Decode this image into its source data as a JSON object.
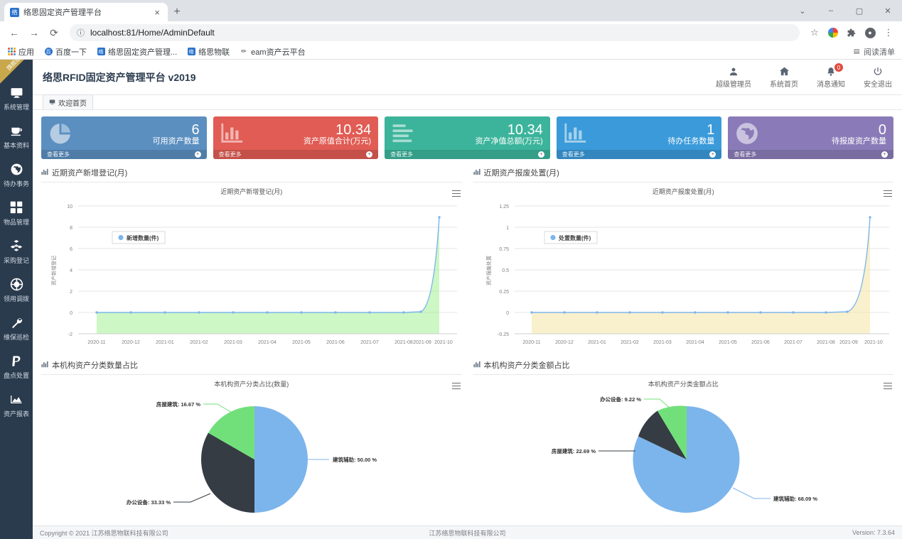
{
  "browser": {
    "tab": {
      "title": "络思固定资产管理平台",
      "favicon_icon": "app-favicon",
      "close_icon": "×"
    },
    "new_tab_icon": "+",
    "window_controls": {
      "minimize_all": "⌄",
      "minimize": "–",
      "maximize": "▢",
      "close": "✕"
    },
    "nav": {
      "back": "←",
      "forward": "→",
      "reload": "⟳",
      "info_icon": "ⓘ"
    },
    "url": "localhost:81/Home/AdminDefault",
    "toolbar_icons": {
      "star": "☆",
      "chrome": "chrome-logo",
      "extensions": "🧩",
      "profile": "👤",
      "menu": "⋮"
    },
    "bookmarks": [
      {
        "label": "应用",
        "icon": "apps-grid-icon"
      },
      {
        "label": "百度一下",
        "icon": "baidu-icon"
      },
      {
        "label": "络思固定资产管理...",
        "icon": "app-favicon"
      },
      {
        "label": "络思物联",
        "icon": "app-favicon"
      },
      {
        "label": "eam资产云平台",
        "icon": "pencil-icon"
      }
    ],
    "reading_list": {
      "label": "阅读清单",
      "icon": "reading-list-icon"
    }
  },
  "sidebar": {
    "ribbon": "旗舰版",
    "items": [
      {
        "label": "系统管理",
        "icon": "monitor-icon"
      },
      {
        "label": "基本资料",
        "icon": "cup-icon"
      },
      {
        "label": "待办事务",
        "icon": "globe-icon"
      },
      {
        "label": "物品管理",
        "icon": "grid-squares-icon"
      },
      {
        "label": "采购登记",
        "icon": "cubes-icon"
      },
      {
        "label": "领用调拨",
        "icon": "lifebuoy-icon"
      },
      {
        "label": "维保巡检",
        "icon": "wrench-icon"
      },
      {
        "label": "盘点处置",
        "icon": "paypal-p-icon"
      },
      {
        "label": "资产报表",
        "icon": "area-chart-icon"
      }
    ]
  },
  "header": {
    "title": "络思RFID固定资产管理平台 v2019",
    "actions": [
      {
        "label": "超级管理员",
        "icon": "user-icon",
        "badge": null
      },
      {
        "label": "系统首页",
        "icon": "home-icon",
        "badge": null
      },
      {
        "label": "消息通知",
        "icon": "bell-icon",
        "badge": "0"
      },
      {
        "label": "安全退出",
        "icon": "power-icon",
        "badge": null
      }
    ],
    "page_tab": {
      "label": "欢迎首页",
      "icon": "monitor-icon"
    }
  },
  "cards": [
    {
      "value": "6",
      "label": "可用资产数量",
      "more": "查看更多",
      "color": "#5b8fc0",
      "icon": "pie-chart-icon",
      "arrow": "+"
    },
    {
      "value": "10.34",
      "label": "资产原值合计(万元)",
      "more": "查看更多",
      "color": "#e05c54",
      "icon": "bar-chart-icon",
      "arrow": "+"
    },
    {
      "value": "10.34",
      "label": "资产净值总额(万元)",
      "more": "查看更多",
      "color": "#3cb49b",
      "icon": "list-lines-icon",
      "arrow": "+"
    },
    {
      "value": "1",
      "label": "待办任务数量",
      "more": "查看更多",
      "color": "#3b9ad9",
      "icon": "bar-chart-icon",
      "arrow": "+"
    },
    {
      "value": "0",
      "label": "待报废资产数量",
      "more": "查看更多",
      "color": "#8a7bb8",
      "icon": "globe-icon",
      "arrow": "+"
    }
  ],
  "panels": [
    {
      "heading": "近期资产新增登记(月)",
      "icon": "chart-icon",
      "menu_icon": "hamburger-icon"
    },
    {
      "heading": "近期资产报废处置(月)",
      "icon": "chart-icon",
      "menu_icon": "hamburger-icon"
    },
    {
      "heading": "本机构资产分类数量占比",
      "icon": "chart-icon",
      "menu_icon": "hamburger-icon"
    },
    {
      "heading": "本机构资产分类金额占比",
      "icon": "chart-icon",
      "menu_icon": "hamburger-icon"
    }
  ],
  "chart_data": [
    {
      "type": "area",
      "title": "近期资产新增登记(月)",
      "xlabel": "",
      "ylabel": "资产新增登记",
      "categories": [
        "2020-11",
        "2020-12",
        "2021-01",
        "2021-02",
        "2021-03",
        "2021-04",
        "2021-05",
        "2021-06",
        "2021-07",
        "2021-08",
        "2021-09",
        "2021-10"
      ],
      "series": [
        {
          "name": "新增数量(件)",
          "values": [
            0,
            0,
            0,
            0,
            0,
            0,
            0,
            0,
            0,
            0,
            0,
            9
          ]
        }
      ],
      "yticks": [
        "-2",
        "0",
        "2",
        "4",
        "6",
        "8",
        "10"
      ],
      "ylim": [
        -2,
        10
      ],
      "grid": true,
      "legend": "top-left",
      "colors": {
        "line": "#7cb5ec",
        "fill": "#90ed7d"
      }
    },
    {
      "type": "area",
      "title": "近期资产报废处置(月)",
      "xlabel": "",
      "ylabel": "资产报废处置",
      "categories": [
        "2020-11",
        "2020-12",
        "2021-01",
        "2021-02",
        "2021-03",
        "2021-04",
        "2021-05",
        "2021-06",
        "2021-07",
        "2021-08",
        "2021-09",
        "2021-10"
      ],
      "series": [
        {
          "name": "处置数量(件)",
          "values": [
            0,
            0,
            0,
            0,
            0,
            0,
            0,
            0,
            0,
            0,
            0,
            1
          ]
        }
      ],
      "yticks": [
        "-0.25",
        "0",
        "0.25",
        "0.5",
        "0.75",
        "1",
        "1.25"
      ],
      "ylim": [
        -0.25,
        1.25
      ],
      "grid": true,
      "legend": "top-left",
      "colors": {
        "line": "#7cb5ec",
        "fill": "#f7e08a"
      }
    },
    {
      "type": "pie",
      "title": "本机构资产分类占比(数量)",
      "labels": [
        "建筑辅助",
        "办公设备",
        "房屋建筑"
      ],
      "values": [
        50.0,
        33.33,
        16.67
      ],
      "value_labels": [
        "建筑辅助: 50.00 %",
        "办公设备: 33.33 %",
        "房屋建筑: 16.67 %"
      ],
      "colors": [
        "#7cb5ec",
        "#353c43",
        "#72e07a"
      ],
      "legend": "bottom"
    },
    {
      "type": "pie",
      "title": "本机构资产分类金额占比",
      "labels": [
        "建筑辅助",
        "房屋建筑",
        "办公设备"
      ],
      "values": [
        68.09,
        22.69,
        9.22
      ],
      "value_labels": [
        "建筑辅助: 68.09 %",
        "房屋建筑: 22.69 %",
        "办公设备: 9.22 %"
      ],
      "colors": [
        "#7cb5ec",
        "#353c43",
        "#72e07a"
      ],
      "legend": "bottom"
    }
  ],
  "footer": {
    "left": "Copyright © 2021  江苏络思物联科技有限公司",
    "mid": "江苏络思物联科技有限公司",
    "right": "Version: 7.3.64"
  }
}
